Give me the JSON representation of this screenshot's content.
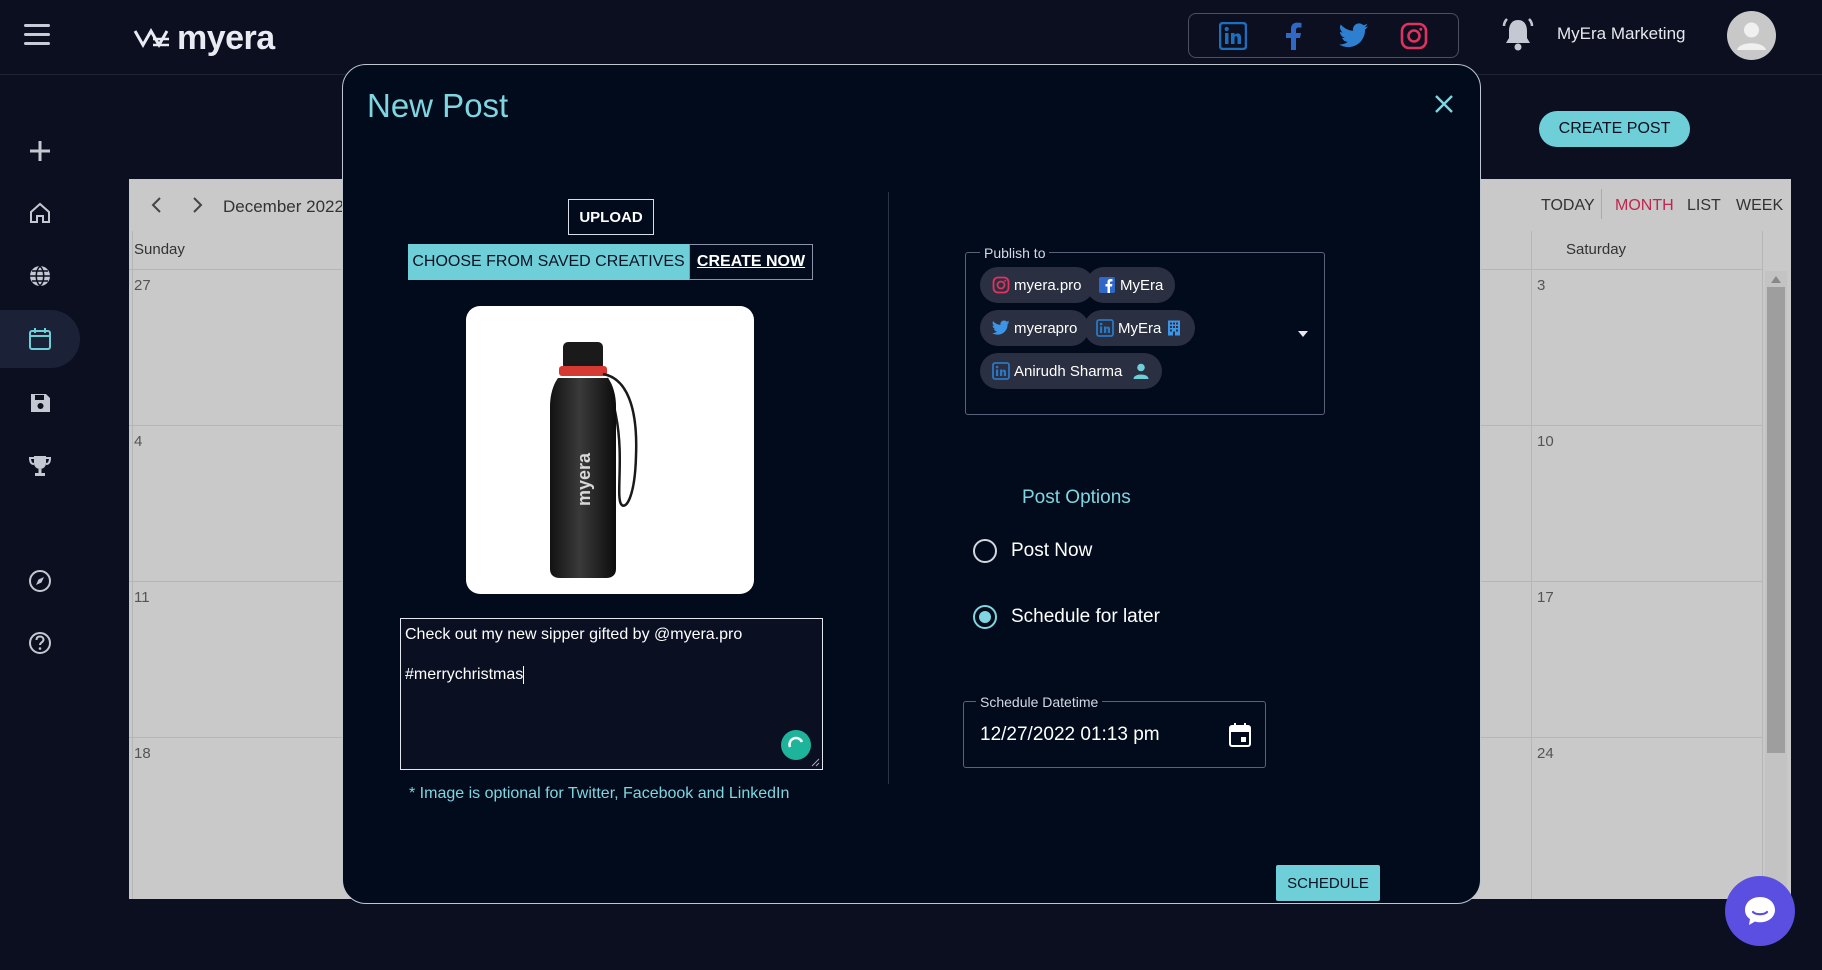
{
  "app": {
    "logo_text": "myera",
    "account_name": "MyEra Marketing"
  },
  "icons": {
    "linkedin": "linkedin-icon",
    "facebook": "facebook-icon",
    "twitter": "twitter-icon",
    "instagram": "instagram-icon",
    "bell": "bell-icon",
    "avatar": "avatar-icon"
  },
  "colors": {
    "accent": "#6ecfd8",
    "modal_bg": "#020b1c",
    "today_active": "#c0264e",
    "spinner": "#1db49b",
    "chat": "#5a4fe0"
  },
  "sidebar": {
    "items": [
      {
        "name": "plus-icon"
      },
      {
        "name": "home-icon"
      },
      {
        "name": "globe-icon"
      },
      {
        "name": "calendar-icon",
        "active": true
      },
      {
        "name": "save-icon"
      },
      {
        "name": "trophy-icon"
      },
      {
        "name": "compass-icon"
      },
      {
        "name": "help-icon"
      }
    ]
  },
  "page": {
    "create_post_label": "CREATE POST"
  },
  "calendar": {
    "month": "December 2022",
    "views": {
      "today": "TODAY",
      "month": "MONTH",
      "list": "LIST",
      "week": "WEEK"
    },
    "day_names": {
      "sunday": "Sunday",
      "saturday": "Saturday"
    },
    "sunday_dates": [
      "27",
      "4",
      "11",
      "18"
    ],
    "saturday_dates": [
      "3",
      "10",
      "17",
      "24"
    ]
  },
  "modal": {
    "title": "New Post",
    "upload_label": "UPLOAD",
    "saved_label": "CHOOSE FROM SAVED CREATIVES",
    "create_now_label": "CREATE NOW",
    "caption_line1": "Check out my new sipper gifted by @myera.pro",
    "caption_line2": "#merrychristmas",
    "image_note": "* Image is optional for Twitter, Facebook and LinkedIn",
    "publish_to": {
      "legend": "Publish to",
      "accounts": [
        {
          "platform": "instagram",
          "label": "myera.pro"
        },
        {
          "platform": "facebook",
          "label": "MyEra"
        },
        {
          "platform": "twitter",
          "label": "myerapro"
        },
        {
          "platform": "linkedin-page",
          "label": "MyEra"
        },
        {
          "platform": "linkedin-person",
          "label": "Anirudh Sharma"
        }
      ]
    },
    "post_options_label": "Post Options",
    "options": {
      "post_now": "Post Now",
      "schedule_later": "Schedule for later",
      "selected": "schedule_later"
    },
    "schedule_datetime": {
      "label": "Schedule Datetime",
      "value": "12/27/2022 01:13 pm"
    },
    "schedule_label": "SCHEDULE"
  }
}
